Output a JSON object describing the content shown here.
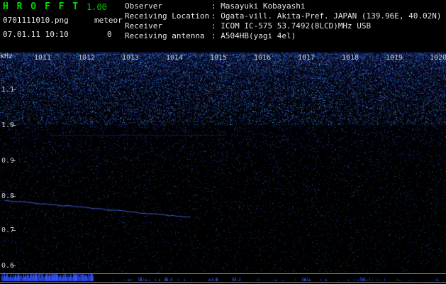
{
  "header": {
    "app_title": "H R O F F T",
    "version": "1.00",
    "filename": "0701111010.png",
    "meteor_label": "meteor",
    "meteor_count": "0",
    "timestamp": "07.01.11 10:10",
    "colon": ": ",
    "info": [
      {
        "label": "Observer",
        "value": "Masayuki Kobayashi"
      },
      {
        "label": "Receiving Location",
        "value": "Ogata-vill. Akita-Pref. JAPAN (139.96E, 40.02N)"
      },
      {
        "label": "Receiver",
        "value": "ICOM IC-575 53.7492(8LCD)MHz USB"
      },
      {
        "label": "Receiving antenna",
        "value": "A504HB(yagi 4el)"
      }
    ]
  },
  "chart_data": {
    "type": "heatmap",
    "title": "",
    "xlabel": "",
    "ylabel": "kHz",
    "x_tick_labels": [
      "1011",
      "1012",
      "1013",
      "1014",
      "1015",
      "1016",
      "1017",
      "1018",
      "1019",
      "1020"
    ],
    "y_tick_labels": [
      "1.1",
      "1.0",
      "0.9",
      "0.8",
      "0.7",
      "0.6"
    ],
    "y_range_khz": [
      0.58,
      1.17
    ],
    "x_range_time": [
      "10:11",
      "10:20"
    ],
    "grid": false,
    "legend": "none",
    "meteor_echo_count": 0,
    "features": [
      {
        "name": "noise-background",
        "description": "blue speckle noise over black, densest near top of band (above ~1.0 kHz), sparser toward bottom"
      },
      {
        "name": "drifting-carrier-line",
        "start": {
          "time": "1011",
          "khz": 0.81
        },
        "end": {
          "time": "1015",
          "khz": 0.76
        },
        "description": "faint blue slowly descending carrier trace on left half"
      },
      {
        "name": "faint-horizontal-trace",
        "khz": 0.98,
        "time_span": [
          "1012",
          "1016"
        ]
      },
      {
        "name": "activity-strip",
        "description": "bottom signal-level strip between two gray rules; continuous bright blue activity from 1011 to ~1013, sparse ticks after"
      }
    ],
    "colors": {
      "background": "#000000",
      "noise_blue": "#2a50e6",
      "strip_rule_gray": "#8a8a8a",
      "label_gray": "#c8c8c8",
      "title_green": "#00d800"
    }
  }
}
